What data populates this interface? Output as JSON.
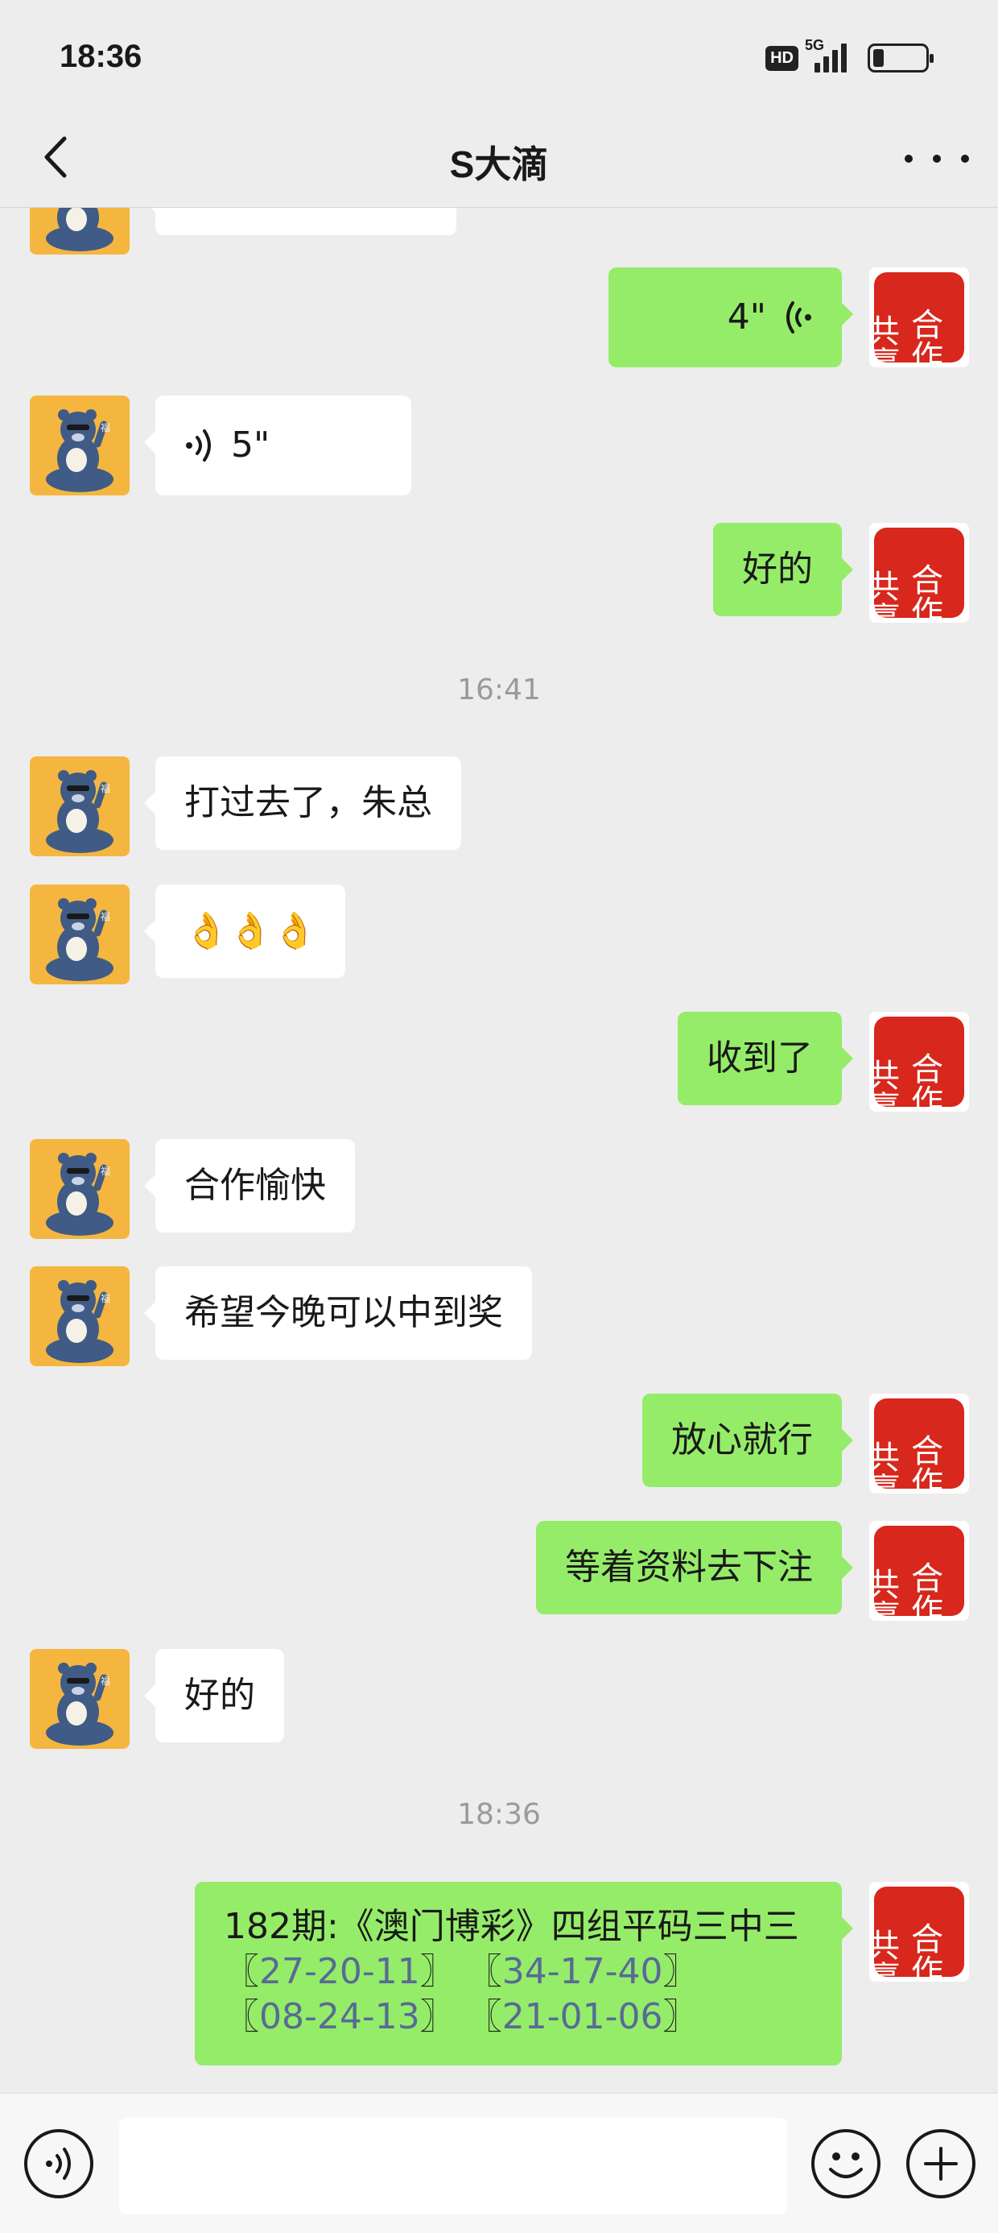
{
  "status_bar": {
    "time": "18:36",
    "hd_badge": "HD",
    "network": "5G",
    "battery_level": 0.2
  },
  "header": {
    "title": "S大滴"
  },
  "messages": {
    "m1": {
      "duration": "4\""
    },
    "m2": {
      "duration": "5\""
    },
    "m3": {
      "text": "好的"
    },
    "ts1": "16:41",
    "m4": {
      "text": "打过去了，朱总"
    },
    "m5": {
      "text": "👌👌👌"
    },
    "m6": {
      "text": "收到了"
    },
    "m7": {
      "text": "合作愉快"
    },
    "m8": {
      "text": "希望今晚可以中到奖"
    },
    "m9": {
      "text": "放心就行"
    },
    "m10": {
      "text": "等着资料去下注"
    },
    "m11": {
      "text": "好的"
    },
    "ts2": "18:36",
    "m12": {
      "line1": "182期:《澳门博彩》四组平码三中三",
      "groups": [
        "27-20-11",
        "34-17-40",
        "08-24-13",
        "21-01-06"
      ]
    }
  },
  "self_avatar": {
    "line_left": "共赢",
    "line_right": "合作"
  },
  "colors": {
    "outgoing_bubble": "#95ec69",
    "incoming_bubble": "#ffffff",
    "background": "#ededed",
    "seal_red": "#d8271c",
    "bear_avatar_bg": "#f4b63f",
    "link_blue": "#576b95"
  },
  "icons": {
    "back": "chevron-left-icon",
    "more": "more-dots-icon",
    "voice": "voice-wave-icon",
    "emoji": "smile-face-icon",
    "plus": "plus-circle-icon"
  }
}
